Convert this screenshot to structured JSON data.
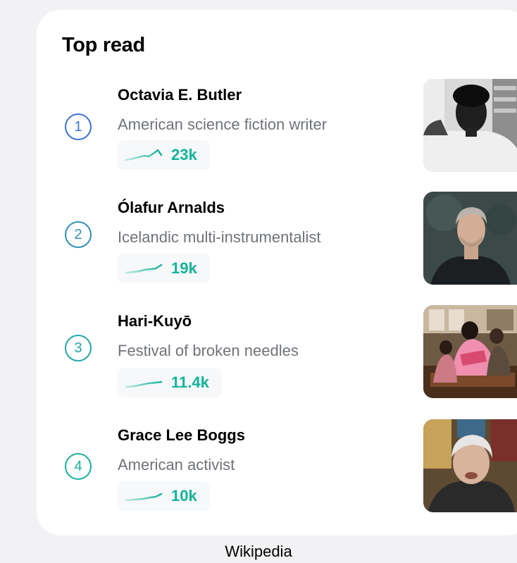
{
  "widget": {
    "title": "Top read",
    "footer": "Wikipedia",
    "accent_blue": "#3366cc",
    "accent_teal": "#14b39a",
    "items": [
      {
        "rank": "1",
        "title": "Octavia E. Butler",
        "description": "American science fiction writer",
        "views": "23k",
        "thumbnail_icon": "portrait-photo"
      },
      {
        "rank": "2",
        "title": "Ólafur Arnalds",
        "description": "Icelandic multi-instrumentalist",
        "views": "19k",
        "thumbnail_icon": "portrait-photo"
      },
      {
        "rank": "3",
        "title": "Hari-Kuyō",
        "description": "Festival of broken needles",
        "views": "11.4k",
        "thumbnail_icon": "event-photo"
      },
      {
        "rank": "4",
        "title": "Grace Lee Boggs",
        "description": "American activist",
        "views": "10k",
        "thumbnail_icon": "portrait-photo"
      }
    ]
  }
}
